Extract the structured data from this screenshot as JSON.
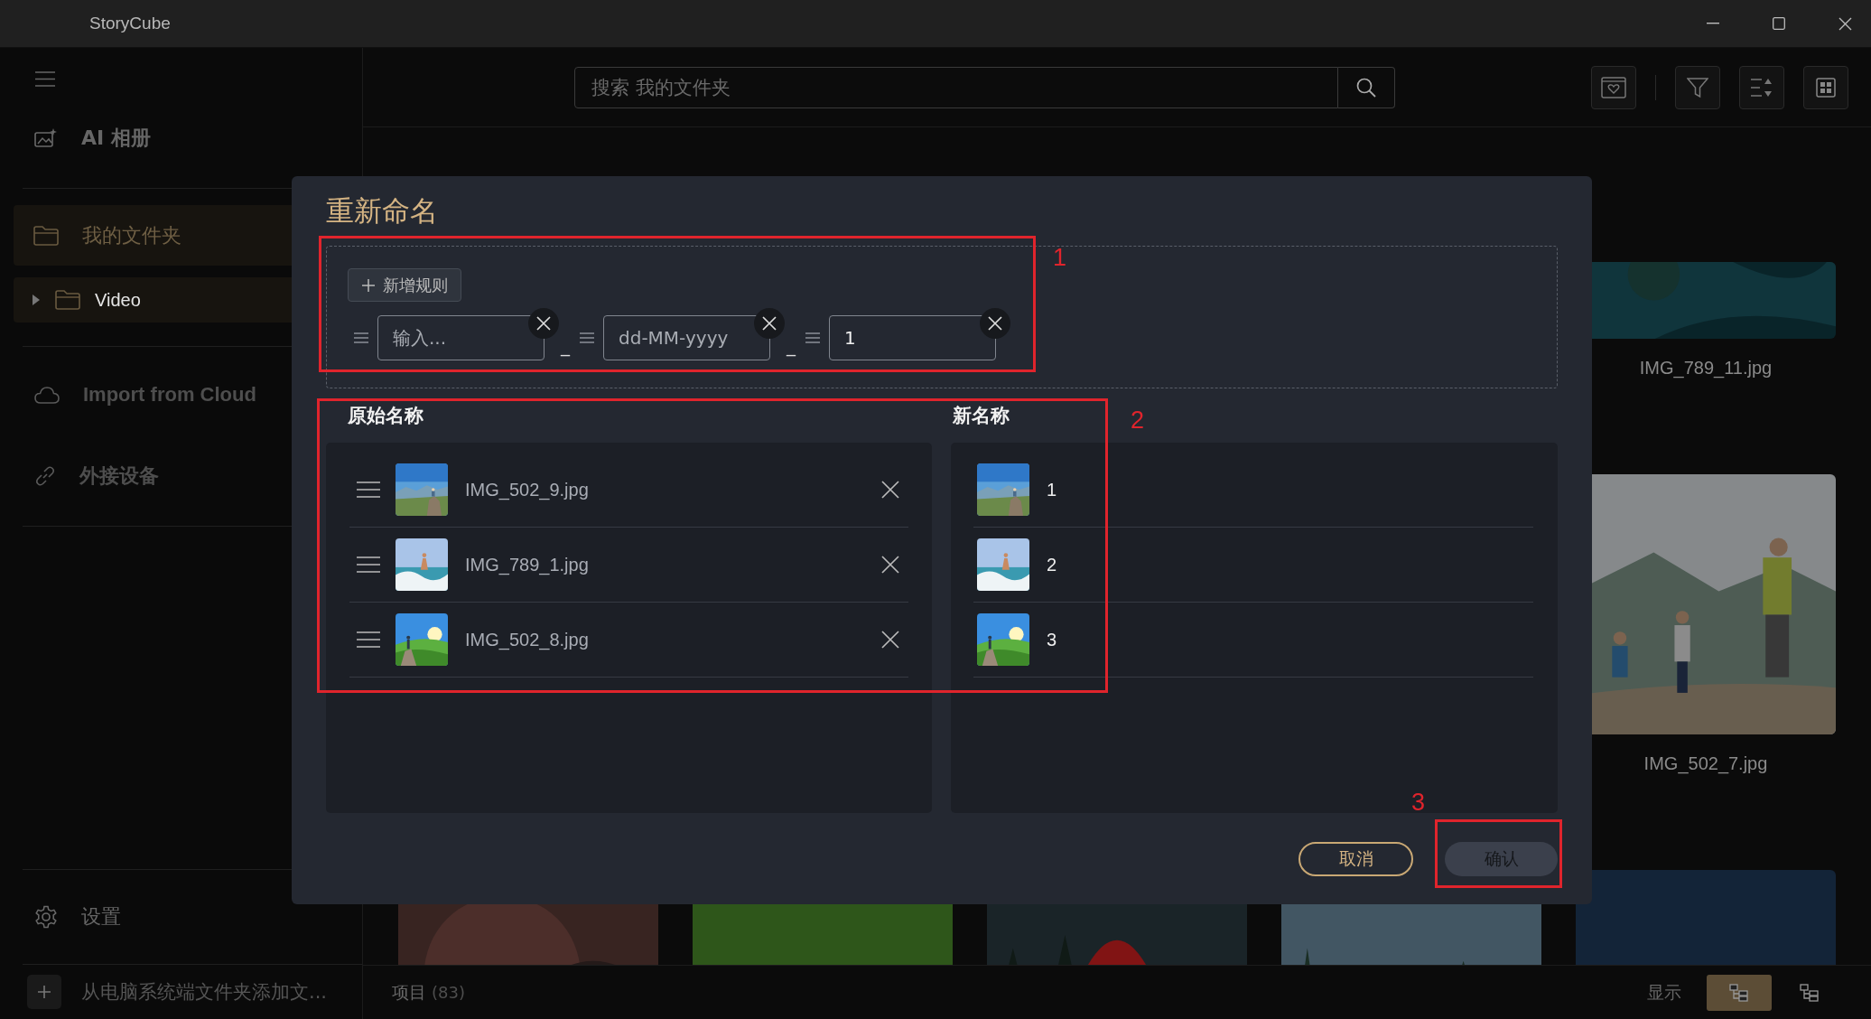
{
  "window": {
    "title": "StoryCube"
  },
  "sidebar": {
    "items": [
      {
        "label": "AI 相册"
      }
    ],
    "folder": {
      "label": "我的文件夹",
      "selected": true,
      "children": [
        {
          "label": "Video",
          "expanded": false
        }
      ]
    },
    "sources": [
      {
        "label": "Import from Cloud"
      },
      {
        "label": "外接设备"
      }
    ],
    "settings": {
      "label": "设置"
    },
    "add_folder": {
      "label": "从电脑系统端文件夹添加文..."
    }
  },
  "search": {
    "placeholder": "搜索 我的文件夹"
  },
  "gallery": {
    "tiles": [
      {
        "kind": "picture",
        "caption": "IMG_789_11.jpg"
      },
      {
        "kind": "picture",
        "caption": "IMG_502_7.jpg"
      },
      {
        "kind": "picture"
      },
      {
        "kind": "picture"
      },
      {
        "kind": "picture"
      },
      {
        "kind": "picture"
      },
      {
        "kind": "picture"
      }
    ]
  },
  "status_bar": {
    "count_label": "项目",
    "count": "(83)",
    "view_label": "显示",
    "views": [
      {
        "selected": true
      },
      {
        "selected": false
      }
    ]
  },
  "dialog": {
    "title": "重新命名",
    "add_rule_button": "新增规则",
    "rules": [
      {
        "kind": "text",
        "placeholder": "输入...",
        "separator": "_"
      },
      {
        "kind": "date",
        "value": "dd-MM-yyyy",
        "separator": "_"
      },
      {
        "kind": "number",
        "value": "1"
      }
    ],
    "columns": {
      "original": "原始名称",
      "new": "新名称"
    },
    "files": [
      {
        "original": "IMG_502_9.jpg",
        "new_name": "1"
      },
      {
        "original": "IMG_789_1.jpg",
        "new_name": "2"
      },
      {
        "original": "IMG_502_8.jpg",
        "new_name": "3"
      }
    ],
    "cancel_button": "取消",
    "confirm_button": {
      "label": "确认",
      "disabled": true
    }
  },
  "annotations": [
    {
      "label": "1"
    },
    {
      "label": "2"
    },
    {
      "label": "3"
    }
  ]
}
